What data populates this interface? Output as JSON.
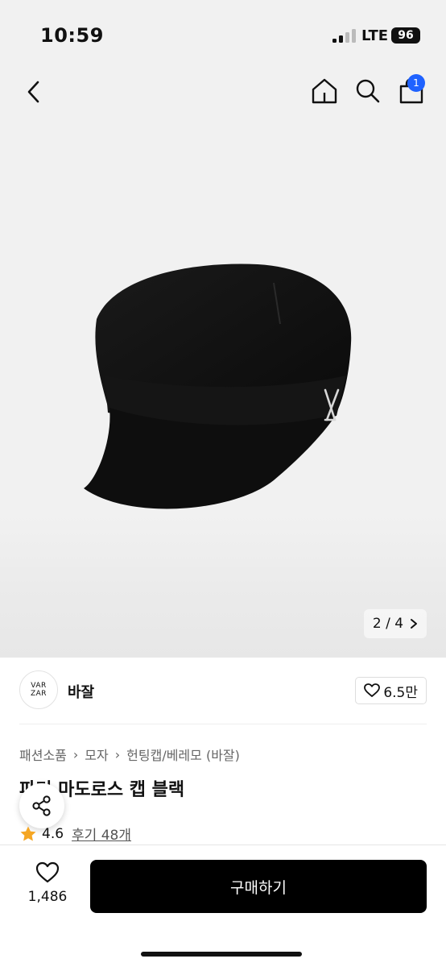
{
  "status": {
    "time": "10:59",
    "network": "LTE",
    "battery": "96"
  },
  "header": {
    "cart_count": "1"
  },
  "gallery": {
    "pager": "2 / 4"
  },
  "brand": {
    "logo_line1": "VAR",
    "logo_line2": "ZAR",
    "name": "바잘",
    "likes": "6.5만"
  },
  "breadcrumb": [
    "패션소품",
    "모자",
    "헌팅캡/베레모 (바잘)"
  ],
  "product": {
    "name": "파리 마도로스 캡 블랙",
    "rating": "4.6",
    "reviews": "후기 48개"
  },
  "bottom": {
    "wish_count": "1,486",
    "buy_label": "구매하기"
  },
  "colors": {
    "accent": "#1f62ff",
    "star": "#f5a623",
    "buy_bg": "#000000"
  },
  "icons": [
    "back-icon",
    "home-icon",
    "search-icon",
    "cart-icon",
    "heart-icon",
    "share-icon",
    "star-icon",
    "chevron-right-icon"
  ]
}
